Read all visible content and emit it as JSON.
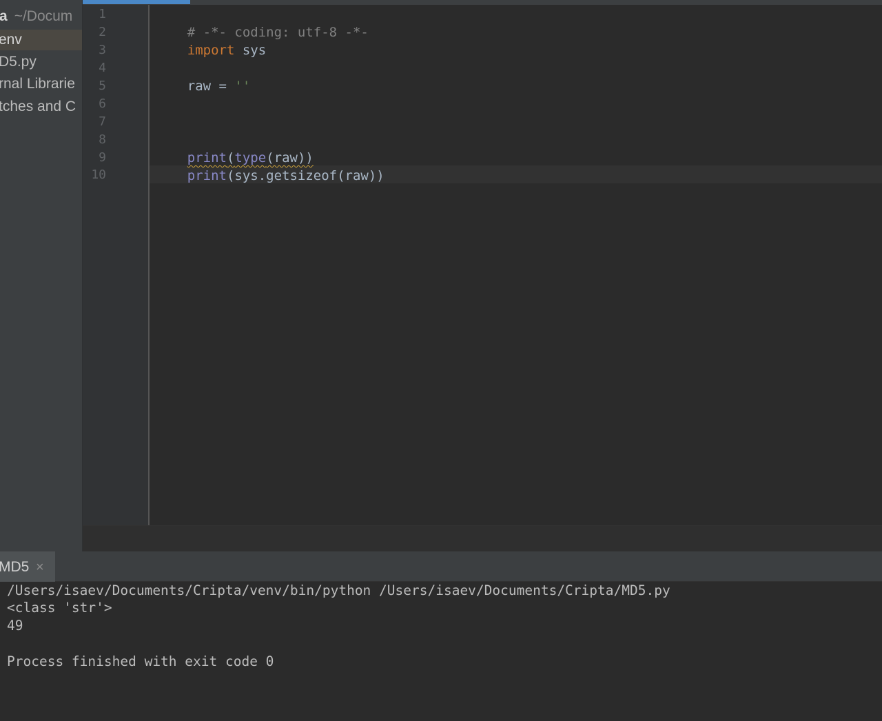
{
  "project_tree": {
    "root_name": "ta",
    "root_path": "~/Docum",
    "items": [
      {
        "label": "env"
      },
      {
        "label": "D5.py"
      },
      {
        "label": "rnal Librarie"
      },
      {
        "label": "tches and C"
      }
    ]
  },
  "editor": {
    "line_numbers": [
      "1",
      "2",
      "3",
      "4",
      "5",
      "6",
      "7",
      "8",
      "9",
      "10"
    ],
    "code": {
      "line1_comment": "# -*- coding: utf-8 -*-",
      "line2_keyword": "import",
      "line2_rest": " sys",
      "line4_var": "raw = ",
      "line4_string": "''",
      "line8_print": "print",
      "line8_open": "(",
      "line8_type": "type",
      "line8_args": "(raw))",
      "line9_print": "print",
      "line9_args": "(sys.getsizeof(raw))"
    }
  },
  "run_panel": {
    "tab_label": "MD5",
    "tab_close": "×",
    "output": [
      "/Users/isaev/Documents/Cripta/venv/bin/python /Users/isaev/Documents/Cripta/MD5.py",
      "<class 'str'>",
      "49",
      "",
      "Process finished with exit code 0"
    ]
  },
  "colors": {
    "keyword": "#cc7832",
    "comment": "#808080",
    "string": "#6a8759",
    "builtin": "#8888c6",
    "tab_indicator": "#4a88c7"
  }
}
